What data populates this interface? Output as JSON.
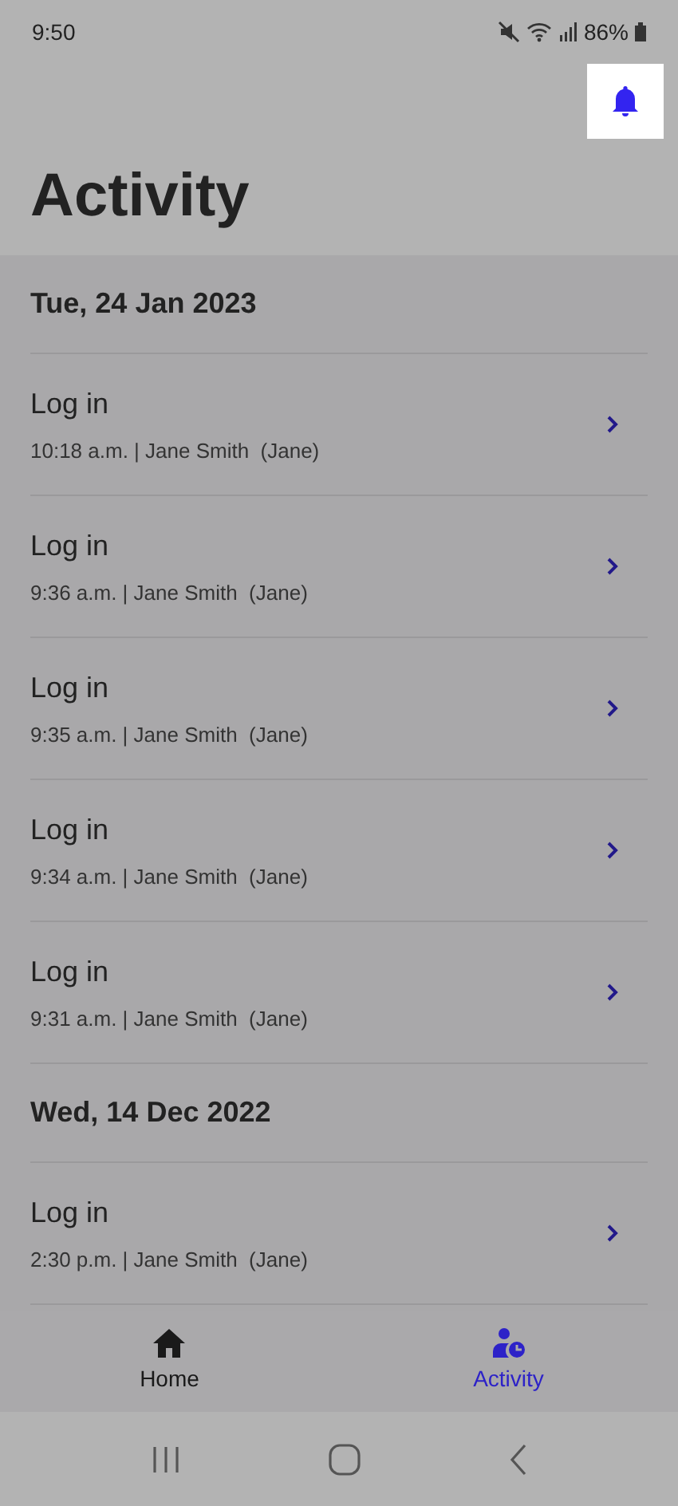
{
  "status_bar": {
    "time": "9:50",
    "battery": "86%"
  },
  "header": {
    "title": "Activity"
  },
  "groups": [
    {
      "date": "Tue, 24 Jan 2023",
      "items": [
        {
          "title": "Log in",
          "detail": "10:18 a.m. | Jane Smith  (Jane)"
        },
        {
          "title": "Log in",
          "detail": "9:36 a.m. | Jane Smith  (Jane)"
        },
        {
          "title": "Log in",
          "detail": "9:35 a.m. | Jane Smith  (Jane)"
        },
        {
          "title": "Log in",
          "detail": "9:34 a.m. | Jane Smith  (Jane)"
        },
        {
          "title": "Log in",
          "detail": "9:31 a.m. | Jane Smith  (Jane)"
        }
      ]
    },
    {
      "date": "Wed, 14 Dec 2022",
      "items": [
        {
          "title": "Log in",
          "detail": "2:30 p.m. | Jane Smith  (Jane)"
        }
      ]
    }
  ],
  "bottom_nav": [
    {
      "kind": "home",
      "label": "Home",
      "selected": false
    },
    {
      "kind": "activity",
      "label": "Activity",
      "selected": true
    }
  ]
}
